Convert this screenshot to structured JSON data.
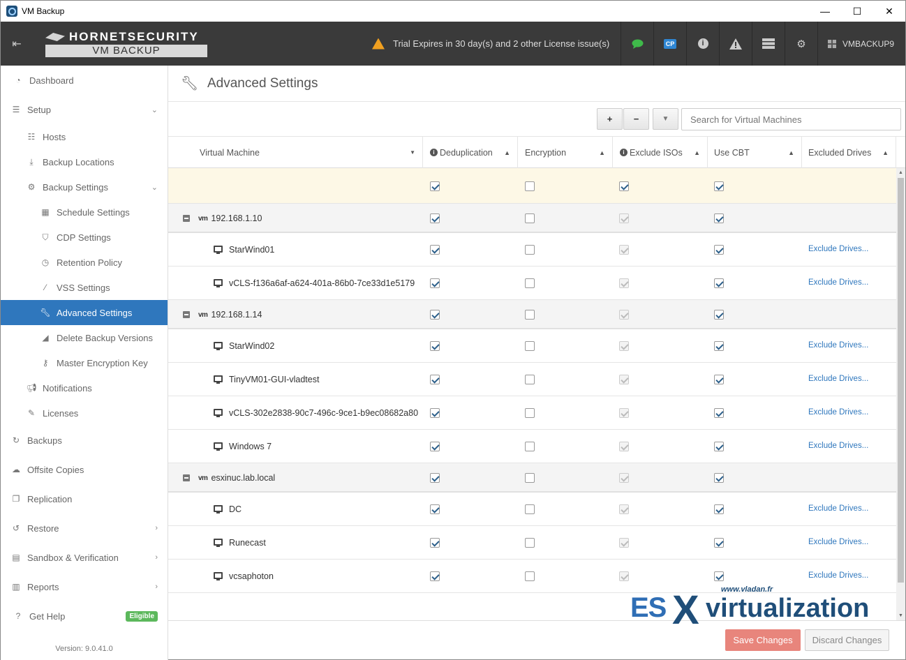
{
  "window": {
    "title": "VM Backup",
    "minimize": "—",
    "maximize": "☐",
    "close": "✕"
  },
  "topbar": {
    "menu_icon": "menu-collapse-icon",
    "logo_top": "HORNETSECURITY",
    "logo_bottom": "VM BACKUP",
    "license_text": "Trial Expires in 30 day(s) and 2 other License issue(s)",
    "icons": [
      "chat-icon",
      "cp-icon",
      "info-icon",
      "alert-icon",
      "server-icon",
      "gears-icon"
    ],
    "cp_label": "CP",
    "chat_color": "#3fba4a",
    "cp_color": "#2f87d4",
    "user": "VMBACKUP9"
  },
  "sidebar": {
    "items": [
      {
        "label": "Dashboard"
      },
      {
        "label": "Setup"
      },
      {
        "label": "Hosts"
      },
      {
        "label": "Backup Locations"
      },
      {
        "label": "Backup Settings"
      },
      {
        "label": "Schedule Settings"
      },
      {
        "label": "CDP Settings"
      },
      {
        "label": "Retention Policy"
      },
      {
        "label": "VSS Settings"
      },
      {
        "label": "Advanced Settings"
      },
      {
        "label": "Delete Backup Versions"
      },
      {
        "label": "Master Encryption Key"
      },
      {
        "label": "Notifications"
      },
      {
        "label": "Licenses"
      },
      {
        "label": "Backups"
      },
      {
        "label": "Offsite Copies"
      },
      {
        "label": "Replication"
      },
      {
        "label": "Restore"
      },
      {
        "label": "Sandbox & Verification"
      },
      {
        "label": "Reports"
      },
      {
        "label": "Get Help"
      }
    ],
    "help_badge": "Eligible",
    "version": "Version: 9.0.41.0"
  },
  "page": {
    "title": "Advanced Settings"
  },
  "toolbar": {
    "expand": "+",
    "collapse": "−",
    "filter": "▼",
    "search_placeholder": "Search for Virtual Machines"
  },
  "columns": {
    "vm": "Virtual Machine",
    "dedup": "Deduplication",
    "encryption": "Encryption",
    "exclude_isos": "Exclude ISOs",
    "use_cbt": "Use CBT",
    "excluded_drives": "Excluded Drives"
  },
  "rows": [
    {
      "type": "host",
      "tag": "vm",
      "name": "192.168.1.10",
      "dedup": true,
      "enc": false,
      "iso": true,
      "cbt": true,
      "link": ""
    },
    {
      "type": "vm",
      "name": "StarWind01",
      "dedup": true,
      "enc": false,
      "iso": true,
      "cbt": true,
      "link": "Exclude Drives..."
    },
    {
      "type": "vm",
      "name": "vCLS-f136a6af-a624-401a-86b0-7ce33d1e5179",
      "dedup": true,
      "enc": false,
      "iso": true,
      "cbt": true,
      "link": "Exclude Drives..."
    },
    {
      "type": "host",
      "tag": "vm",
      "name": "192.168.1.14",
      "dedup": true,
      "enc": false,
      "iso": true,
      "cbt": true,
      "link": ""
    },
    {
      "type": "vm",
      "name": "StarWind02",
      "dedup": true,
      "enc": false,
      "iso": true,
      "cbt": true,
      "link": "Exclude Drives..."
    },
    {
      "type": "vm",
      "name": "TinyVM01-GUI-vladtest",
      "dedup": true,
      "enc": false,
      "iso": true,
      "cbt": true,
      "link": "Exclude Drives..."
    },
    {
      "type": "vm",
      "name": "vCLS-302e2838-90c7-496c-9ce1-b9ec08682a80",
      "dedup": true,
      "enc": false,
      "iso": true,
      "cbt": true,
      "link": "Exclude Drives..."
    },
    {
      "type": "vm",
      "name": "Windows 7",
      "dedup": true,
      "enc": false,
      "iso": true,
      "cbt": true,
      "link": "Exclude Drives..."
    },
    {
      "type": "host",
      "tag": "vm",
      "name": "esxinuc.lab.local",
      "dedup": true,
      "enc": false,
      "iso": true,
      "cbt": true,
      "link": ""
    },
    {
      "type": "vm",
      "name": "DC",
      "dedup": true,
      "enc": false,
      "iso": true,
      "cbt": true,
      "link": "Exclude Drives..."
    },
    {
      "type": "vm",
      "name": "Runecast",
      "dedup": true,
      "enc": false,
      "iso": true,
      "cbt": true,
      "link": "Exclude Drives..."
    },
    {
      "type": "vm",
      "name": "vcsaphoton",
      "dedup": true,
      "enc": false,
      "iso": true,
      "cbt": true,
      "link": "Exclude Drives..."
    }
  ],
  "filter_row": {
    "dedup": true,
    "enc": false,
    "iso": true,
    "cbt": true
  },
  "footer": {
    "save": "Save Changes",
    "discard": "Discard Changes"
  },
  "watermark": {
    "url": "www.vladan.fr",
    "es": "ES",
    "x": "X",
    "rest": "virtualization"
  }
}
